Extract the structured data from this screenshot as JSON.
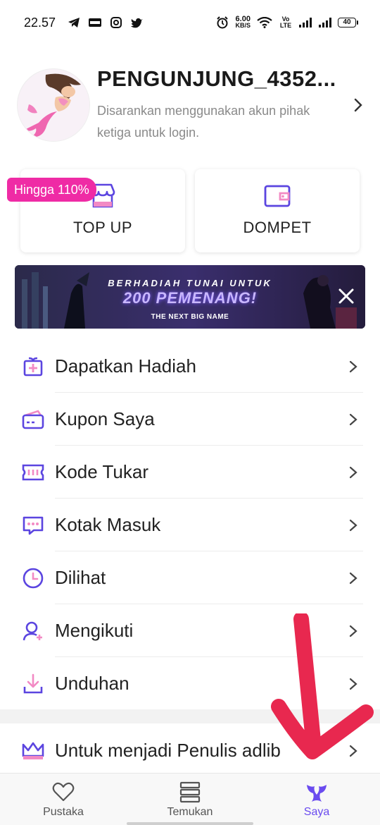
{
  "status": {
    "time": "22.57",
    "net_speed_value": "6.00",
    "net_speed_unit": "KB/S",
    "volte": "Vo LTE",
    "battery": "40",
    "left_icons": [
      "telegram-icon",
      "webtoon-icon",
      "instagram-icon",
      "twitter-icon"
    ],
    "right_icons": [
      "alarm-icon",
      "wifi-icon",
      "signal-icon",
      "signal-icon"
    ]
  },
  "profile": {
    "name": "PENGUNJUNG_4352...",
    "hint": "Disarankan menggunakan akun pihak ketiga untuk login."
  },
  "cards": {
    "badge": "Hingga 110%",
    "topup_label": "TOP UP",
    "dompet_label": "DOMPET"
  },
  "banner": {
    "line1": "BERHADIAH TUNAI UNTUK",
    "line2": "200 PEMENANG!",
    "line3": "THE NEXT BIG NAME"
  },
  "menu": {
    "items": [
      {
        "label": "Dapatkan Hadiah",
        "icon": "gift-icon"
      },
      {
        "label": "Kupon Saya",
        "icon": "coupon-icon"
      },
      {
        "label": "Kode Tukar",
        "icon": "ticket-icon"
      },
      {
        "label": "Kotak Masuk",
        "icon": "message-icon"
      },
      {
        "label": "Dilihat",
        "icon": "clock-icon"
      },
      {
        "label": "Mengikuti",
        "icon": "user-plus-icon"
      },
      {
        "label": "Unduhan",
        "icon": "download-icon"
      }
    ],
    "writer_label": "Untuk menjadi Penulis adlib"
  },
  "nav": {
    "items": [
      {
        "label": "Pustaka",
        "icon": "heart-icon"
      },
      {
        "label": "Temukan",
        "icon": "stack-icon"
      },
      {
        "label": "Saya",
        "icon": "mermaid-tail-icon"
      }
    ],
    "active": "Saya"
  },
  "colors": {
    "accent": "#6a4bef",
    "badge": "#ef2ba5",
    "annotation": "#e8284f"
  }
}
